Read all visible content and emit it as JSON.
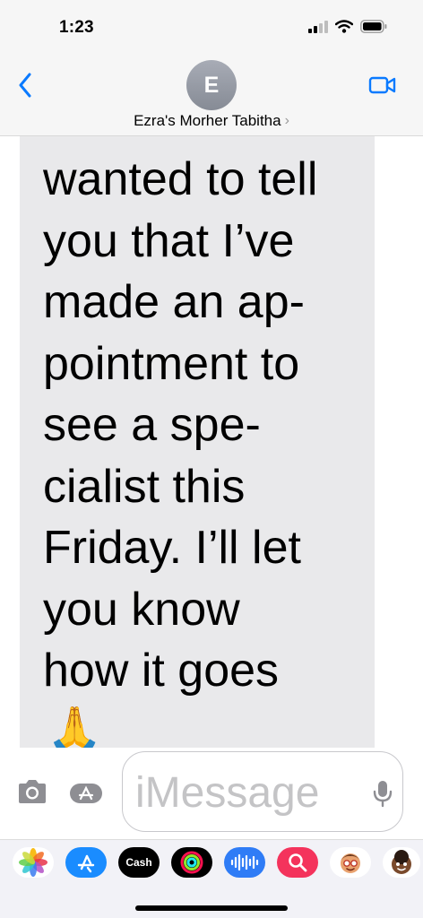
{
  "status_bar": {
    "time": "1:23"
  },
  "header": {
    "avatar_initial": "E",
    "contact_name": "Ezra's Morher Tabitha",
    "chevron": "›",
    "back_icon": "chevron-left-icon",
    "video_icon": "video-camera-icon"
  },
  "message": {
    "lines": [
      "wanted to tell",
      "you that I’ve",
      "made an ap-",
      "pointment to",
      "see a spe-",
      "cialist this",
      "Friday. I’ll let",
      "you know",
      "how it goes"
    ],
    "emoji": "🙏"
  },
  "composer": {
    "placeholder": "iMessage",
    "camera_icon": "camera-icon",
    "apps_icon": "app-store-icon",
    "mic_icon": "microphone-icon"
  },
  "drawer": {
    "apps": [
      {
        "name": "photos-icon"
      },
      {
        "name": "app-store-icon"
      },
      {
        "name": "apple-cash-icon",
        "label": "Cash"
      },
      {
        "name": "activity-icon"
      },
      {
        "name": "audio-message-icon"
      },
      {
        "name": "search-images-icon"
      },
      {
        "name": "memoji-icon"
      },
      {
        "name": "memoji-stickers-icon"
      }
    ]
  },
  "colors": {
    "accent": "#0a7aff",
    "bubble": "#e9e9eb",
    "header_bg": "#f6f6f6"
  }
}
